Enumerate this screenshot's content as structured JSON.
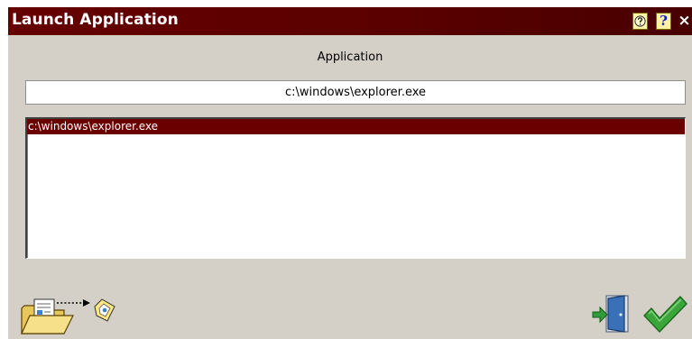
{
  "window": {
    "title": "Launch Application",
    "help_icon": "context-help-icon",
    "help_label": "?",
    "close_label": "×"
  },
  "form": {
    "section_label": "Application",
    "path_value": "c:\\windows\\explorer.exe"
  },
  "list": {
    "items": [
      {
        "label": "c:\\windows\\explorer.exe",
        "selected": true
      }
    ]
  },
  "actions": {
    "browse_icon": "folder-open-icon",
    "exit_icon": "exit-door-icon",
    "ok_icon": "checkmark-icon"
  },
  "colors": {
    "titlebar": "#5b0000",
    "selection": "#6b0000",
    "dialog_bg": "#d4d0c8",
    "ok_green": "#2e9a2e"
  }
}
